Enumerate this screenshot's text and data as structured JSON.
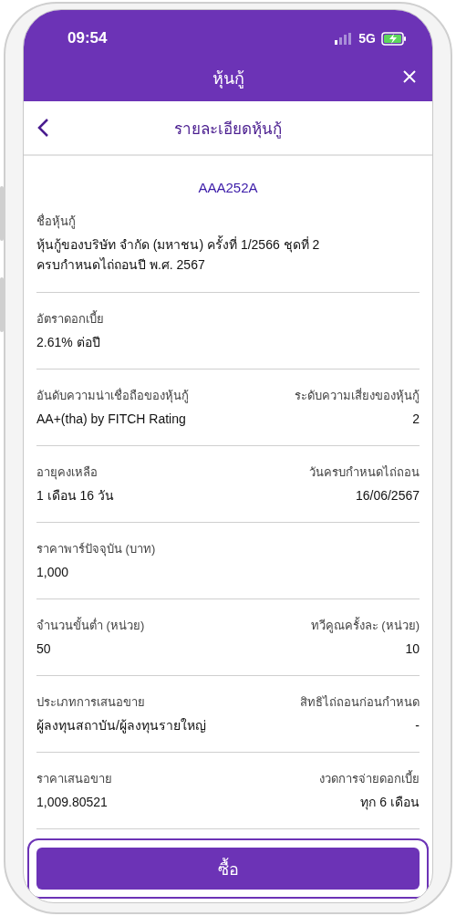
{
  "status_bar": {
    "time": "09:54",
    "network": "5G"
  },
  "header": {
    "title": "หุ้นกู้"
  },
  "subheader": {
    "title": "รายละเอียดหุ้นกู้"
  },
  "bond_code": "AAA252A",
  "sections": [
    {
      "fields": [
        {
          "label": "ชื่อหุ้นกู้",
          "value_lines": [
            "หุ้นกู้ของบริษัท จำกัด (มหาชน) ครั้งที่ 1/2566 ชุดที่ 2",
            "ครบกำหนดไถ่ถอนปี พ.ศ. 2567"
          ]
        }
      ]
    },
    {
      "fields": [
        {
          "label": "อัตราดอกเบี้ย",
          "value_lines": [
            "2.61% ต่อปี"
          ]
        }
      ]
    },
    {
      "fields": [
        {
          "label": "อันดับความน่าเชื่อถือของหุ้นกู้",
          "value_lines": [
            "AA+(tha) by FITCH Rating"
          ]
        },
        {
          "label": "ระดับความเสี่ยงของหุ้นกู้",
          "value_lines": [
            "2"
          ]
        }
      ]
    },
    {
      "fields": [
        {
          "label": "อายุคงเหลือ",
          "value_lines": [
            "1 เดือน  16 วัน"
          ]
        },
        {
          "label": "วันครบกำหนดไถ่ถอน",
          "value_lines": [
            "16/06/2567"
          ]
        }
      ]
    },
    {
      "fields": [
        {
          "label": "ราคาพาร์ปัจจุบัน (บาท)",
          "value_lines": [
            "1,000"
          ]
        }
      ]
    },
    {
      "fields": [
        {
          "label": "จำนวนขั้นต่ำ (หน่วย)",
          "value_lines": [
            "50"
          ]
        },
        {
          "label": "ทวีคูณครั้งละ (หน่วย)",
          "value_lines": [
            "10"
          ]
        }
      ]
    },
    {
      "fields": [
        {
          "label": "ประเภทการเสนอขาย",
          "value_lines": [
            "ผู้ลงทุนสถาบัน/ผู้ลงทุนรายใหญ่"
          ]
        },
        {
          "label": "สิทธิไถ่ถอนก่อนกำหนด",
          "value_lines": [
            "-"
          ]
        }
      ]
    },
    {
      "fields": [
        {
          "label": "ราคาเสนอขาย",
          "value_lines": [
            "1,009.80521"
          ]
        },
        {
          "label": "งวดการจ่ายดอกเบี้ย",
          "value_lines": [
            "ทุก 6 เดือน"
          ]
        }
      ]
    }
  ],
  "buy_button": "ซื้อ"
}
